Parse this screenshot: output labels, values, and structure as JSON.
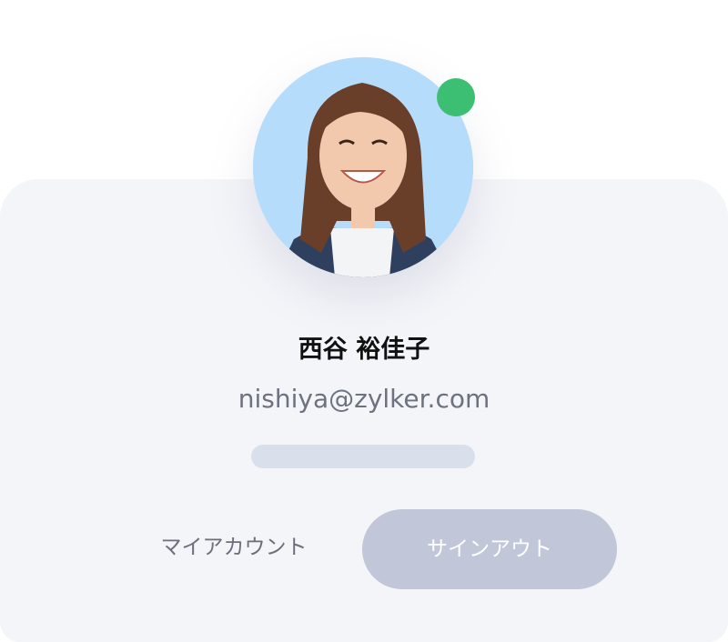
{
  "profile": {
    "name": "西谷 裕佳子",
    "email": "nishiya@zylker.com",
    "status": "online",
    "status_color": "#3dbf73",
    "avatar_icon": "user-photo-avatar"
  },
  "actions": {
    "my_account_label": "マイアカウント",
    "sign_out_label": "サインアウト"
  },
  "colors": {
    "card_bg": "#f4f5f9",
    "avatar_bg": "#b6dcfb",
    "sign_out_bg": "#c1c7d9",
    "placeholder_bar": "#dadfec"
  }
}
